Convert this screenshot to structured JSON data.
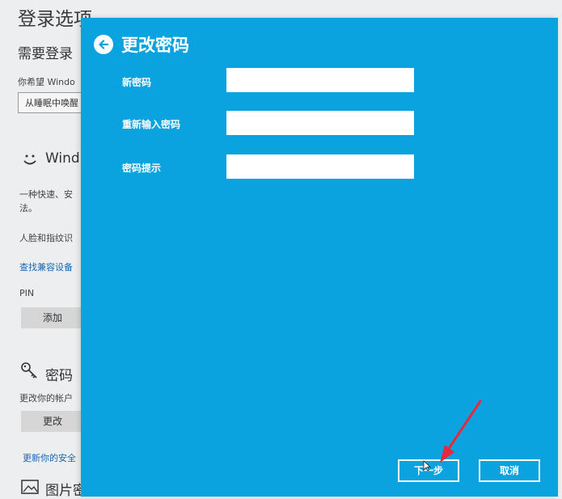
{
  "background": {
    "page_title": "登录选项",
    "section_need_login": "需要登录",
    "question_text": "你希望 Windo",
    "select_value": "从睡眠中唤醒",
    "windows_hello": "Wind",
    "hello_desc_1": "一种快速、安",
    "hello_desc_2": "法。",
    "face_fingerprint": "人脸和指纹识",
    "find_devices_link": "查找兼容设备",
    "pin_label": "PIN",
    "pin_add_button": "添加",
    "password_heading": "密码",
    "password_desc": "更改你的帐户",
    "password_change_button": "更改",
    "update_security_link": "更新你的安全",
    "picture_password": "图片密"
  },
  "dialog": {
    "title": "更改密码",
    "fields": [
      {
        "label": "新密码",
        "value": ""
      },
      {
        "label": "重新输入密码",
        "value": ""
      },
      {
        "label": "密码提示",
        "value": ""
      }
    ],
    "next_button": "下一步",
    "cancel_button": "取消"
  },
  "colors": {
    "dialog_bg": "#0aa3e0",
    "annotation_arrow": "#e8283c"
  },
  "icons": {
    "back": "arrow-left-circle-icon",
    "hello": "smiley-icon",
    "password": "key-icon",
    "picture": "picture-icon",
    "annotation": "red-arrow-icon",
    "cursor": "mouse-cursor-icon"
  }
}
